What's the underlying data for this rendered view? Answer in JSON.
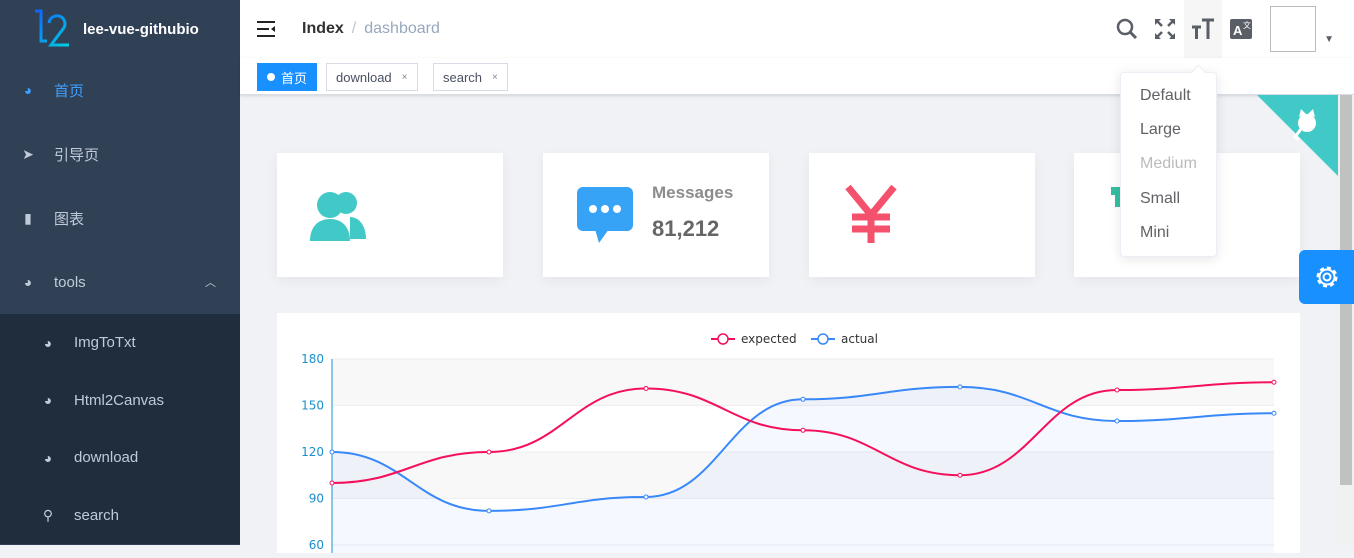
{
  "app": {
    "title": "lee-vue-githubio"
  },
  "sidebar": {
    "items": [
      {
        "label": "首页",
        "icon": "dashboard-icon",
        "active": true
      },
      {
        "label": "引导页",
        "icon": "paper-plane-icon"
      },
      {
        "label": "图表",
        "icon": "bar-chart-icon"
      },
      {
        "label": "tools",
        "icon": "dashboard-icon",
        "expanded": true
      }
    ],
    "subitems": [
      {
        "label": "ImgToTxt",
        "icon": "dashboard-icon"
      },
      {
        "label": "Html2Canvas",
        "icon": "dashboard-icon"
      },
      {
        "label": "download",
        "icon": "dashboard-icon"
      },
      {
        "label": "search",
        "icon": "search-icon"
      }
    ]
  },
  "breadcrumb": {
    "root": "Index",
    "sep": "/",
    "current": "dashboard"
  },
  "tags": [
    {
      "label": "首页",
      "active": true
    },
    {
      "label": "download",
      "close": "×"
    },
    {
      "label": "search",
      "close": "×"
    }
  ],
  "cards": [
    {
      "icon": "peoples-icon",
      "color": "#40c9c6"
    },
    {
      "icon": "message-icon",
      "color": "#36a3f7",
      "label": "Messages",
      "value": "81,212"
    },
    {
      "icon": "money-icon",
      "color": "#f4516c"
    },
    {
      "icon": "shopping-icon",
      "color": "#34bfa3"
    }
  ],
  "size_menu": {
    "options": [
      {
        "label": "Default"
      },
      {
        "label": "Large"
      },
      {
        "label": "Medium",
        "disabled": true
      },
      {
        "label": "Small"
      },
      {
        "label": "Mini"
      }
    ]
  },
  "colors": {
    "accent": "#409EFF",
    "sidebar": "#304156",
    "expected": "#f5105c",
    "actual": "#3888fa"
  },
  "chart_data": {
    "type": "line",
    "smooth": true,
    "legend": [
      "expected",
      "actual"
    ],
    "legend_position": "top",
    "yticks": [
      60,
      90,
      120,
      150,
      180
    ],
    "ylim_visible": [
      60,
      180
    ],
    "series": [
      {
        "name": "expected",
        "values": [
          100,
          120,
          161,
          134,
          105,
          160,
          165
        ],
        "color": "#f5105c"
      },
      {
        "name": "actual",
        "values": [
          120,
          82,
          91,
          154,
          162,
          140,
          145
        ],
        "color": "#3888fa",
        "area": true
      }
    ]
  }
}
